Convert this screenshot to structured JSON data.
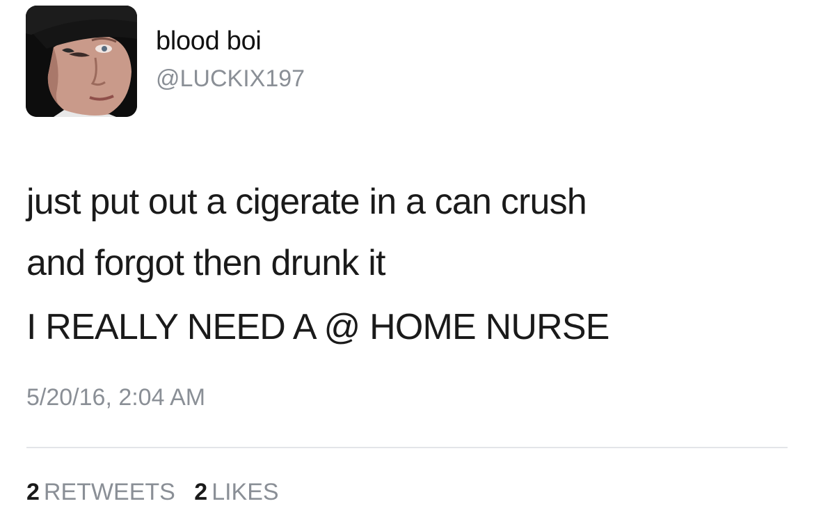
{
  "user": {
    "display_name": "blood boi",
    "handle": "@LUCKIX197"
  },
  "tweet": {
    "paragraphs": [
      "just put out a cigerate in a can crush\nand forgot then drunk it",
      "I REALLY NEED A @ HOME NURSE"
    ],
    "timestamp": "5/20/16, 2:04 AM"
  },
  "stats": {
    "retweets_count": "2",
    "retweets_label": "RETWEETS",
    "likes_count": "2",
    "likes_label": "LIKES"
  },
  "colors": {
    "text": "#1a1a1a",
    "muted": "#8a8f96",
    "divider": "#e3e5e8"
  }
}
